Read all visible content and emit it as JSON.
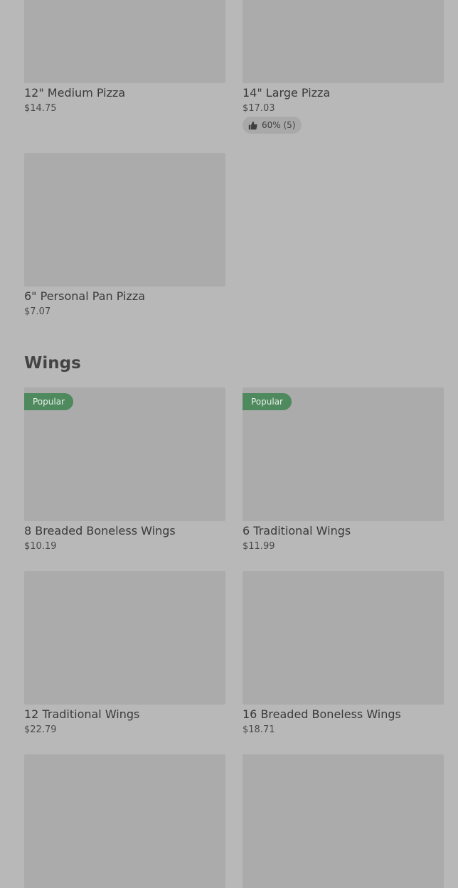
{
  "pizza": {
    "items": [
      {
        "name": "12\" Medium Pizza",
        "price": "$14.75"
      },
      {
        "name": "14\" Large Pizza",
        "price": "$17.03",
        "rating": "60% (5)"
      },
      {
        "name": "6\" Personal Pan Pizza",
        "price": "$7.07"
      }
    ]
  },
  "wings": {
    "title": "Wings",
    "badge_label": "Popular",
    "items": [
      {
        "name": "8 Breaded Boneless Wings",
        "price": "$10.19",
        "badge": "Popular"
      },
      {
        "name": "6 Traditional Wings",
        "price": "$11.99",
        "badge": "Popular"
      },
      {
        "name": "12 Traditional Wings",
        "price": "$22.79"
      },
      {
        "name": "16 Breaded Boneless Wings",
        "price": "$18.71"
      }
    ]
  },
  "icons": {
    "rating": "thumbs-up-icon"
  },
  "colors": {
    "background": "#b8b8b8",
    "image_placeholder": "#ababab",
    "badge": "#4f8a5e"
  }
}
